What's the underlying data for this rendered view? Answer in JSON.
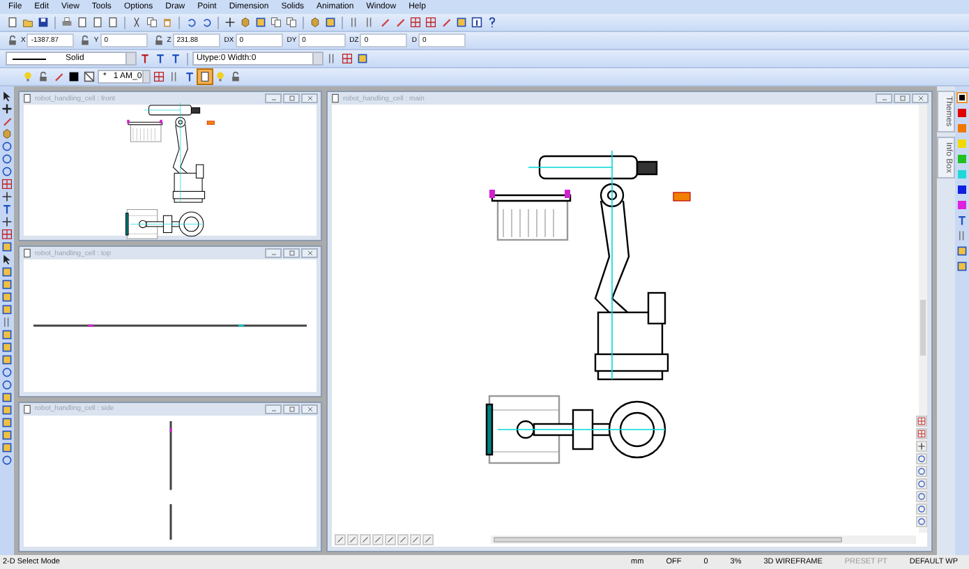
{
  "menu": [
    "File",
    "Edit",
    "View",
    "Tools",
    "Options",
    "Draw",
    "Point",
    "Dimension",
    "Solids",
    "Animation",
    "Window",
    "Help"
  ],
  "coordinates": [
    {
      "label": "X",
      "value": "-1387.87",
      "lock": true
    },
    {
      "label": "Y",
      "value": "0",
      "lock": true
    },
    {
      "label": "Z",
      "value": "231.88",
      "lock": true
    },
    {
      "label": "DX",
      "value": "0",
      "lock": false
    },
    {
      "label": "DY",
      "value": "0",
      "lock": false
    },
    {
      "label": "DZ",
      "value": "0",
      "lock": false
    },
    {
      "label": "D",
      "value": "0",
      "lock": false
    }
  ],
  "line_style": {
    "value": "Solid"
  },
  "line_type": {
    "value": "Utype:0 Width:0"
  },
  "layer": {
    "marker": "*",
    "value": "1 AM_0"
  },
  "windows": [
    {
      "title": "robot_handling_cell : front",
      "kind": "front"
    },
    {
      "title": "robot_handling_cell : top",
      "kind": "top"
    },
    {
      "title": "robot_handling_cell : side",
      "kind": "side"
    },
    {
      "title": "robot_handling_cell : main",
      "kind": "main"
    }
  ],
  "side_tabs": [
    {
      "label": "Themes"
    },
    {
      "label": "Info Box"
    }
  ],
  "palette": [
    {
      "color": "#000000",
      "selected": true
    },
    {
      "color": "#e00000",
      "selected": false
    },
    {
      "color": "#f07800",
      "selected": false
    },
    {
      "color": "#f0d800",
      "selected": false
    },
    {
      "color": "#20c020",
      "selected": false
    },
    {
      "color": "#20d8d8",
      "selected": false
    },
    {
      "color": "#1020e0",
      "selected": false
    },
    {
      "color": "#e020e0",
      "selected": false
    }
  ],
  "status_bar": {
    "mode": "2-D Select Mode",
    "fields": [
      {
        "text": "mm",
        "disabled": false
      },
      {
        "text": "OFF",
        "disabled": false
      },
      {
        "text": "0",
        "disabled": false
      },
      {
        "text": "3%",
        "disabled": false
      },
      {
        "text": "3D WIREFRAME",
        "disabled": false
      },
      {
        "text": "PRESET PT",
        "disabled": true
      },
      {
        "text": "DEFAULT WP",
        "disabled": false
      }
    ]
  }
}
